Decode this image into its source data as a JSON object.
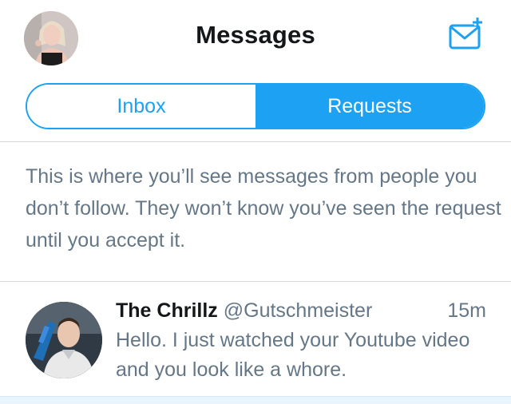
{
  "header": {
    "title": "Messages",
    "compose_icon": "compose-message-icon",
    "avatar_icon": "profile-avatar"
  },
  "tabs": [
    {
      "label": "Inbox",
      "selected": false
    },
    {
      "label": "Requests",
      "selected": true
    }
  ],
  "info_text": "This is where you’ll see messages from people you don’t follow. They won’t know you’ve seen the request until you accept it.",
  "requests": [
    {
      "name": "The Chrillz",
      "handle": "@Gutschmeister",
      "time": "15m",
      "preview": "Hello. I just watched your Youtube video and you look like a whore."
    }
  ],
  "colors": {
    "accent": "#1da1f2",
    "text_primary": "#14171a",
    "text_secondary": "#657786"
  }
}
